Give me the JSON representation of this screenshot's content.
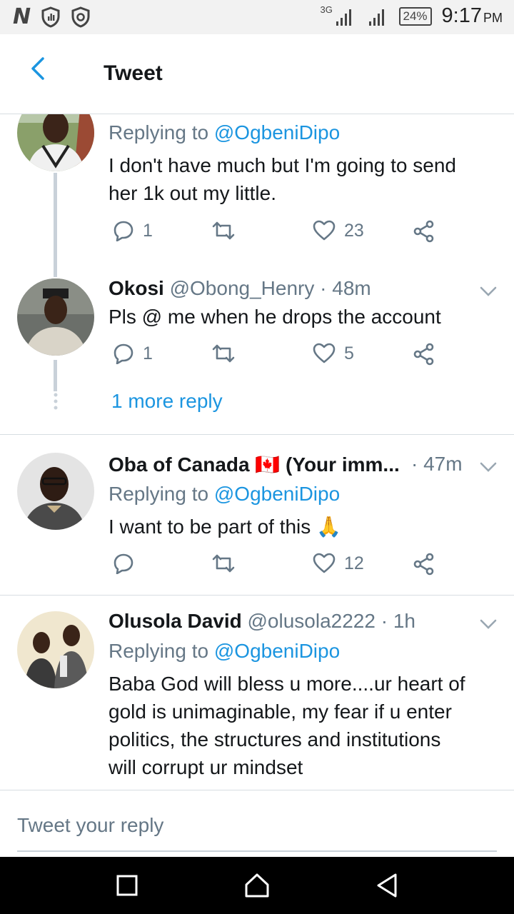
{
  "status_bar": {
    "network_label": "3G",
    "battery": "24%",
    "time": "9:17",
    "ampm": "PM"
  },
  "header": {
    "title": "Tweet"
  },
  "tweets": [
    {
      "replying_prefix": "Replying to ",
      "replying_to": "@OgbeniDipo",
      "text_line1": "I don't have much but I'm going to send",
      "text_line2": "her 1k out my little.",
      "replies": "1",
      "likes": "23"
    },
    {
      "name": "Okosi",
      "handle": "@Obong_Henry",
      "time": " · 48m",
      "text": "Pls @ me when he drops the account",
      "replies": "1",
      "likes": "5"
    },
    {
      "name": "Oba of Canada",
      "flag": "🇨🇦",
      "name_suffix": "(Your imm...",
      "time": "· 47m",
      "replying_prefix": "Replying to ",
      "replying_to": "@OgbeniDipo",
      "text": "I want to be part of this",
      "emoji": "🙏",
      "likes": "12"
    },
    {
      "name": "Olusola David",
      "handle": "@olusola2222",
      "time": " · 1h",
      "replying_prefix": "Replying to ",
      "replying_to": "@OgbeniDipo",
      "text_line1": "Baba God will bless u more....ur heart of",
      "text_line2": "gold is unimaginable, my fear if u enter",
      "text_line3": "politics, the structures and institutions",
      "text_line4": "will corrupt ur mindset"
    }
  ],
  "more_reply": "1 more reply",
  "reply_bar": {
    "placeholder": "Tweet your reply"
  },
  "colors": {
    "accent": "#1b95e0",
    "secondary_text": "#657786",
    "divider": "#d7dde2"
  }
}
